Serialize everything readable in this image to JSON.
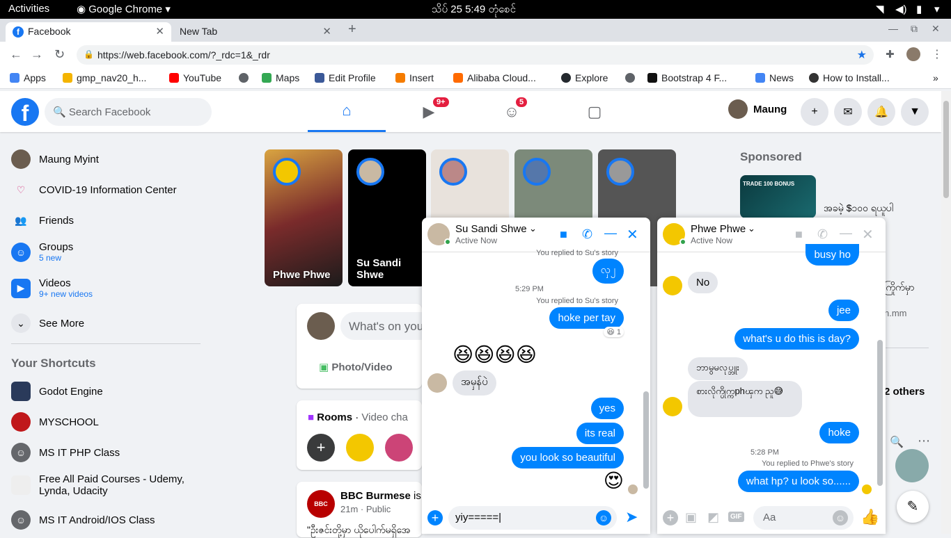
{
  "system": {
    "activities": "Activities",
    "app": "Google Chrome",
    "clock": "သိပ် 25   5:49 တုံစေင်"
  },
  "tabs": [
    {
      "label": "Facebook"
    },
    {
      "label": "New Tab"
    }
  ],
  "address": {
    "url": "https://web.facebook.com/?_rdc=1&_rdr"
  },
  "bookmarks": [
    "Apps",
    "gmp_nav20_h...",
    "YouTube",
    "Maps",
    "Edit Profile",
    "Insert",
    "Alibaba Cloud...",
    "Explore",
    "Bootstrap 4 F...",
    "News",
    "How to Install..."
  ],
  "fb": {
    "search_placeholder": "Search Facebook",
    "user": "Maung",
    "badges": {
      "watch": "9+",
      "groups": "5"
    },
    "left": [
      {
        "label": "Maung Myint"
      },
      {
        "label": "COVID-19 Information Center"
      },
      {
        "label": "Friends"
      },
      {
        "label": "Groups",
        "sub": "5 new"
      },
      {
        "label": "Videos",
        "sub": "9+ new videos"
      },
      {
        "label": "See More"
      }
    ],
    "shortcuts_title": "Your Shortcuts",
    "shortcuts": [
      {
        "label": "Godot Engine"
      },
      {
        "label": "MYSCHOOL"
      },
      {
        "label": "MS IT PHP Class"
      },
      {
        "label": "Free All Paid Courses - Udemy, Lynda, Udacity"
      },
      {
        "label": "MS IT Android/IOS Class"
      }
    ],
    "stories": [
      {
        "name": "Phwe Phwe"
      },
      {
        "name": "Su Sandi Shwe"
      }
    ],
    "composer": {
      "placeholder": "What's on you",
      "photo": "Photo/Video"
    },
    "rooms": {
      "title": "Rooms",
      "sub": "Video cha"
    },
    "post": {
      "author": "BBC Burmese",
      "after": "is",
      "meta": "21m · Public",
      "text": "\"ဦးဇင်းတို့မှာ ယိုပေါက်မရှိအေ"
    },
    "sponsored": {
      "title": "Sponsored",
      "ad_text": "အခမဲ့ $၁၀၀ ရယူပါ",
      "ad_text2": "ကြိုက်မှာ",
      "ad_url": "n.mm",
      "others": "2 others",
      "ad_banner": "TRADE 100 BONUS"
    }
  },
  "chat1": {
    "name": "Su Sandi Shwe",
    "status": "Active Now",
    "replied1": "You replied to Su's story",
    "m1": "လှ၂",
    "time": "5:29 PM",
    "replied2": "You replied to Su's story",
    "m2": "hoke per tay",
    "react": "😆 1",
    "emoji": "😆😆😆😆",
    "their": "အမှန်ပဲ",
    "m3": "yes",
    "m4": "its real",
    "m5": "you look so beautiful",
    "heart": "😍",
    "input": "yiy====="
  },
  "chat2": {
    "name": "Phwe Phwe",
    "status": "Active Now",
    "m0": "busy ho",
    "t1": "No",
    "m1": "jee",
    "m2": "what's u do this is day?",
    "t2": "ဘာမွမလုပ္ဘူး",
    "t3": "စားလိုက္ပိုက္ကphၾက ညူ😅",
    "m3": "hoke",
    "time": "5:28 PM",
    "replied": "You replied to Phwe's story",
    "m4": "what hp? u look so......",
    "input_placeholder": "Aa"
  }
}
